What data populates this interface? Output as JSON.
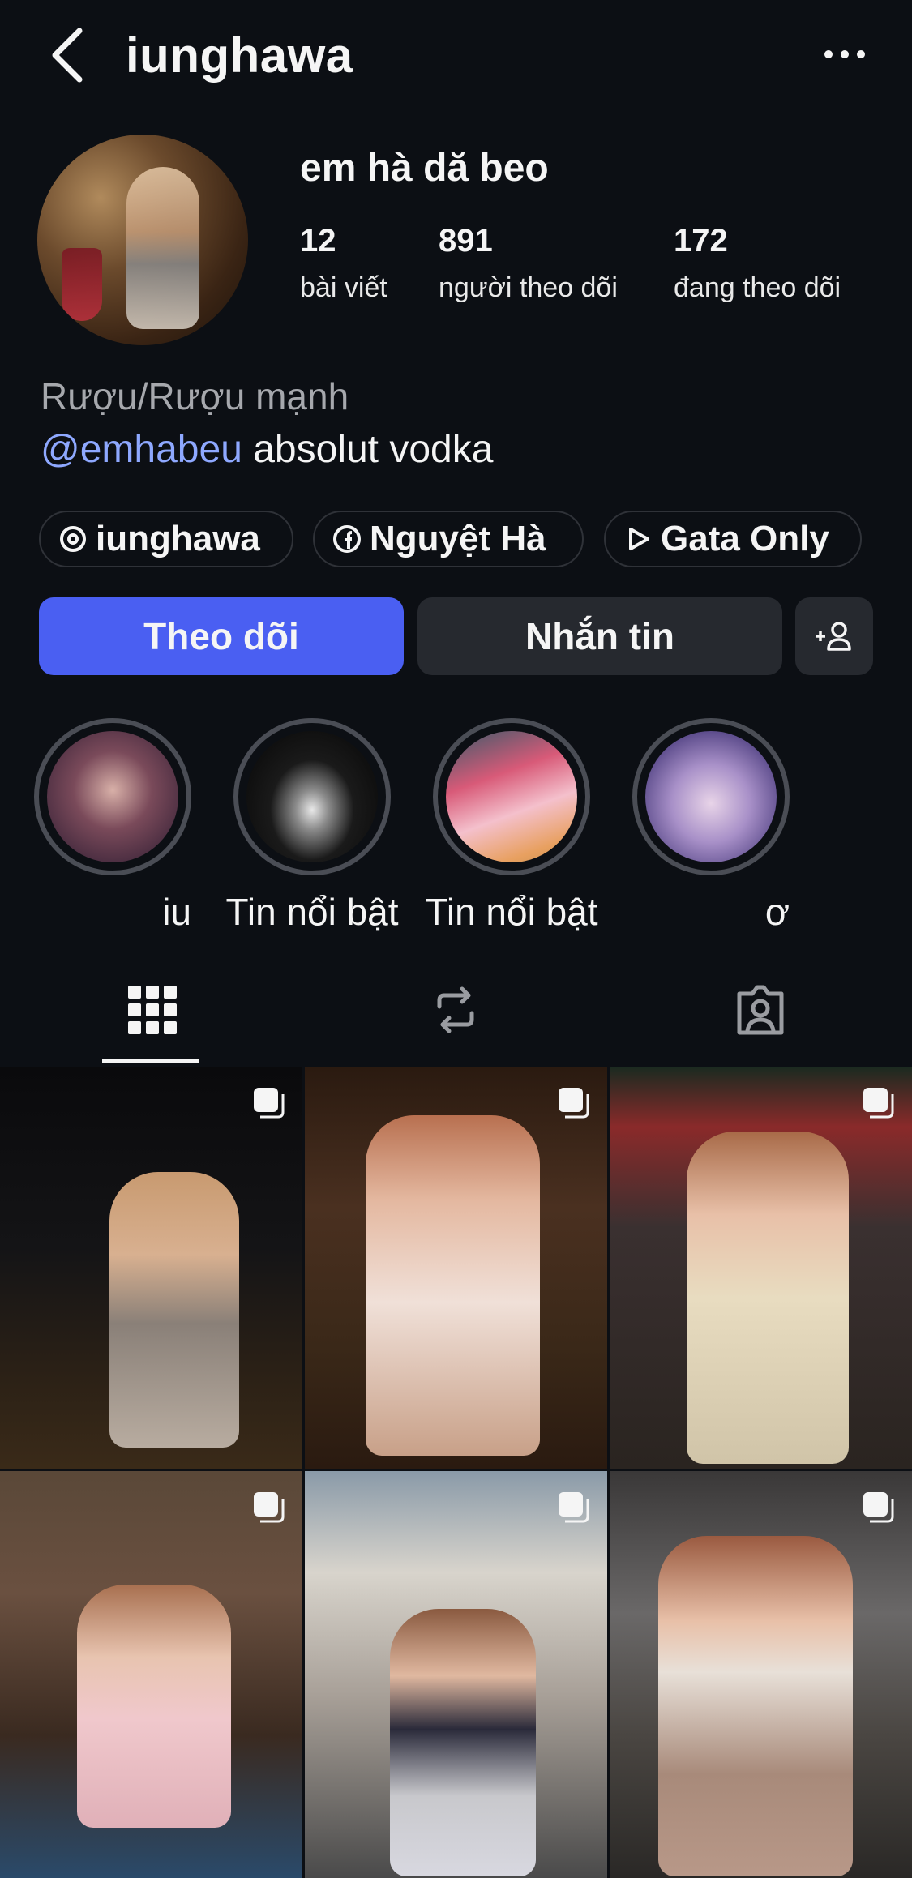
{
  "header": {
    "username": "iunghawa"
  },
  "profile": {
    "display_name": "em hà dă beo",
    "stats": [
      {
        "value": "12",
        "label": "bài viết"
      },
      {
        "value": "891",
        "label": "người theo dõi"
      },
      {
        "value": "172",
        "label": "đang theo dõi"
      }
    ],
    "category": "Rượu/Rượu mạnh",
    "bio_mention": "@emhabeu",
    "bio_text": " absolut vodka"
  },
  "links": [
    {
      "icon": "threads-icon",
      "label": "iunghawa"
    },
    {
      "icon": "facebook-icon",
      "label": "Nguyệt Hà"
    },
    {
      "icon": "play-icon",
      "label": "Gata Only"
    }
  ],
  "actions": {
    "follow_label": "Theo dõi",
    "message_label": "Nhắn tin"
  },
  "highlights": [
    {
      "label": "iu"
    },
    {
      "label": "Tin nổi bật"
    },
    {
      "label": "Tin nổi bật"
    },
    {
      "label": "ơ"
    }
  ],
  "tabs": [
    {
      "icon": "grid-icon",
      "active": true
    },
    {
      "icon": "repost-icon",
      "active": false
    },
    {
      "icon": "tagged-icon",
      "active": false
    }
  ],
  "colors": {
    "background": "#0c0f14",
    "follow_button": "#4a5ff2",
    "secondary_button": "#26292f",
    "mention": "#8ea8ff"
  }
}
